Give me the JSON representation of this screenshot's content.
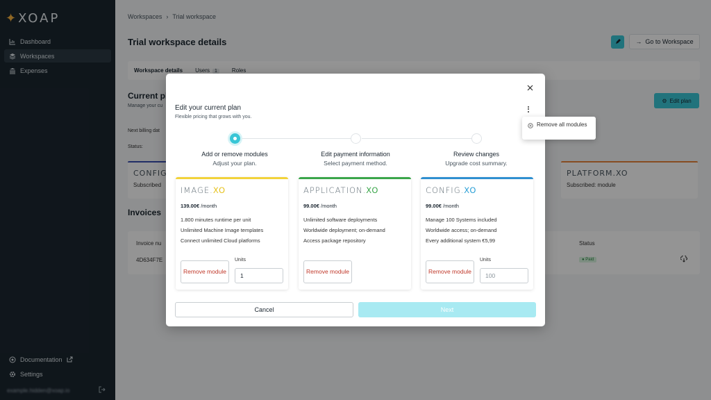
{
  "sidebar": {
    "logo": "XOAP",
    "items": [
      {
        "label": "Dashboard",
        "icon": "chart-icon"
      },
      {
        "label": "Workspaces",
        "icon": "layers-icon"
      },
      {
        "label": "Expenses",
        "icon": "bank-icon"
      }
    ],
    "bottom": [
      {
        "label": "Documentation",
        "icon": "help-icon"
      },
      {
        "label": "Settings",
        "icon": "gear-icon"
      }
    ],
    "user_email": "example.hidden@xoap.io"
  },
  "header": {
    "breadcrumb": [
      "Workspaces",
      "Trial workspace"
    ],
    "title": "Trial workspace details",
    "goto_label": "Go to Workspace"
  },
  "tabs": [
    {
      "label": "Workspace details"
    },
    {
      "label": "Users",
      "count": "1"
    },
    {
      "label": "Roles"
    }
  ],
  "plan_section": {
    "title": "Current pla",
    "subtitle": "Manage your cu",
    "edit_label": "Edit plan",
    "billing_label": "Next billing dat",
    "status_label": "Status:",
    "cards": [
      {
        "name": "CONFIG.X",
        "sub": "Subscribed",
        "color": "#3a4fb0"
      },
      {
        "name": "PLATFORM.XO",
        "sub": "Subscribed: module",
        "color": "#e8833a"
      }
    ]
  },
  "invoices": {
    "title": "Invoices",
    "col_invoice": "Invoice nu",
    "col_status": "Status",
    "row_id": "4D634F7E",
    "row_status": "Paid"
  },
  "modal": {
    "title": "Edit your current plan",
    "subtitle": "Flexible pricing that grows with you.",
    "steps": [
      {
        "title": "Add or remove modules",
        "desc": "Adjust your plan."
      },
      {
        "title": "Edit payment information",
        "desc": "Select payment method."
      },
      {
        "title": "Review changes",
        "desc": "Upgrade cost summary."
      }
    ],
    "modules": [
      {
        "name_main": "IMAGE.",
        "name_xo": "XO",
        "price": "139.00€",
        "period": "/month",
        "features": [
          "1.800 minutes runtime per unit",
          "Unlimited Machine Image templates",
          "Connect unlimited Cloud platforms"
        ],
        "remove_label": "Remove module",
        "units_label": "Units",
        "units_value": "1",
        "accent": "#f2d33a",
        "xo_color": "#e6c21f"
      },
      {
        "name_main": "APPLICATION.",
        "name_xo": "XO",
        "price": "99.00€",
        "period": "/month",
        "features": [
          "Unlimited software deployments",
          "Worldwide deployment; on-demand",
          "Access package repository"
        ],
        "remove_label": "Remove module",
        "accent": "#3aa64a",
        "xo_color": "#3aa64a"
      },
      {
        "name_main": "CONFIG.",
        "name_xo": "XO",
        "price": "99.00€",
        "period": "/month",
        "features": [
          "Manage 100 Systems included",
          "Worldwide access; on-demand",
          "Every additional system €5,99"
        ],
        "remove_label": "Remove module",
        "units_label": "Units",
        "units_placeholder": "100",
        "accent": "#2f8fd0",
        "xo_color": "#2a9fd6"
      }
    ],
    "cancel_label": "Cancel",
    "next_label": "Next",
    "menu": {
      "remove_all": "Remove all modules"
    }
  }
}
